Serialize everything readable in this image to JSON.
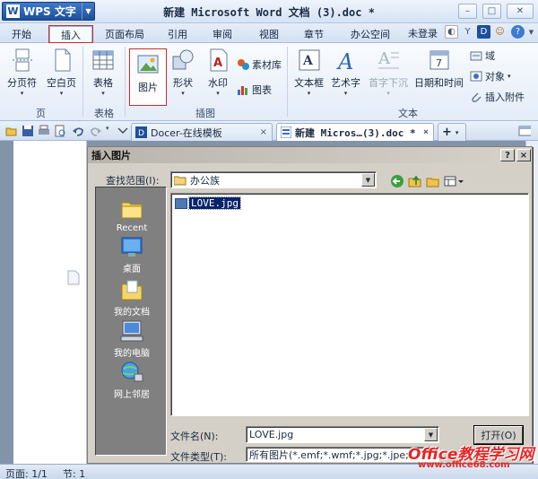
{
  "app": {
    "name": "WPS 文字",
    "logo_letter": "W",
    "document_title": "新建 Microsoft Word 文档 (3).doc *"
  },
  "menu": {
    "tabs": [
      "开始",
      "插入",
      "页面布局",
      "引用",
      "审阅",
      "视图",
      "章节",
      "办公空间"
    ],
    "active_tab": "插入",
    "login_status": "未登录"
  },
  "ribbon": {
    "page_group": {
      "label": "页",
      "buttons": [
        "分页符",
        "空白页"
      ]
    },
    "table_group": {
      "label": "表格",
      "buttons": [
        "表格"
      ]
    },
    "illustration_group": {
      "label": "插图",
      "buttons": [
        "图片",
        "形状",
        "水印"
      ],
      "small": [
        "素材库",
        "图表"
      ]
    },
    "text_group": {
      "label": "文本",
      "buttons": [
        "文本框",
        "艺术字",
        "首字下沉",
        "日期和时间"
      ],
      "small": [
        "域",
        "对象",
        "插入附件"
      ]
    },
    "selected_button": "图片"
  },
  "doc_tabs": {
    "tabs": [
      {
        "label": "Docer-在线模板",
        "close": "×"
      },
      {
        "label": "新建 Micros…(3).doc *",
        "close": "×"
      }
    ],
    "add_label": "+"
  },
  "dialog": {
    "title": "插入图片",
    "help_btn": "?",
    "close_btn": "×",
    "look_in_label": "查找范围(I):",
    "look_in_value": "办公族",
    "places": [
      "Recent",
      "桌面",
      "我的文档",
      "我的电脑",
      "网上邻居"
    ],
    "files": [
      "LOVE.jpg"
    ],
    "filename_label": "文件名(N):",
    "filename_value": "LOVE.jpg",
    "filetype_label": "文件类型(T):",
    "filetype_value": "所有图片(*.emf;*.wmf;*.jpg;*.jpe;",
    "open_btn": "打开(O)"
  },
  "statusbar": {
    "page": "页面: 1/1",
    "section": "节: 1"
  },
  "watermark": {
    "line1": "Office教程学习网",
    "line2": "www.office68.com"
  },
  "colors": {
    "accent_red": "#d42a2a",
    "app_blue": "#1d4f9c",
    "selection": "#0a246a"
  }
}
